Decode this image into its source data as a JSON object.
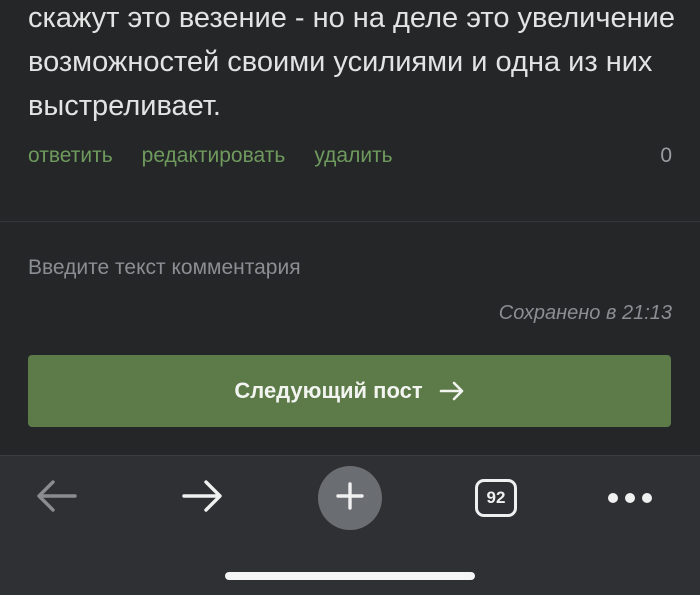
{
  "comment": {
    "text": "скажут это везение - но на деле это увеличение возможностей своими усилиями и одна из них выстреливает."
  },
  "actions": {
    "reply": "ответить",
    "edit": "редактировать",
    "delete": "удалить",
    "rating": "0"
  },
  "comment_form": {
    "placeholder": "Введите текст комментария",
    "saved_status": "Сохранено в 21:13"
  },
  "next_post": {
    "label": "Следующий пост"
  },
  "toolbar": {
    "back_icon": "arrow-left",
    "forward_icon": "arrow-right",
    "new_tab_icon": "plus",
    "tab_count": "92",
    "more_icon": "ellipsis"
  },
  "colors": {
    "background": "#242628",
    "link": "#6f9a5d",
    "button": "#5d7a49",
    "toolbar": "#2e3033"
  }
}
